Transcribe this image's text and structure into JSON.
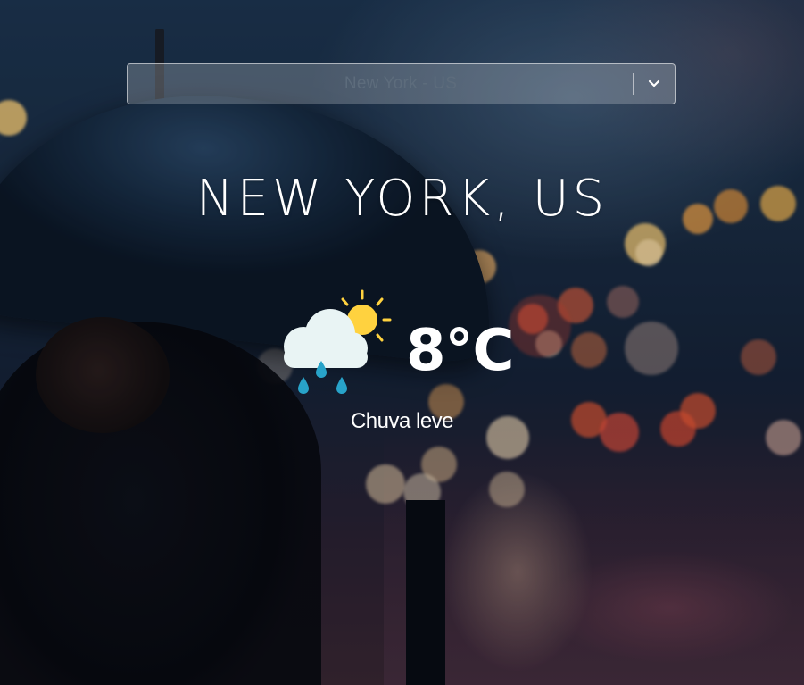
{
  "city_select": {
    "selected_value": "New York - US",
    "arrow_icon": "chevron-down-icon"
  },
  "weather": {
    "city_title": "NEW YORK, US",
    "temperature": "8°C",
    "description": "Chuva leve",
    "icon": "partly-cloudy-rain-icon"
  },
  "colors": {
    "text": "#ffffff",
    "select_text": "#5d6c7c",
    "sun": "#ffd23f",
    "cloud": "#e9f4f4",
    "rain_drop": "#28a3c9"
  }
}
